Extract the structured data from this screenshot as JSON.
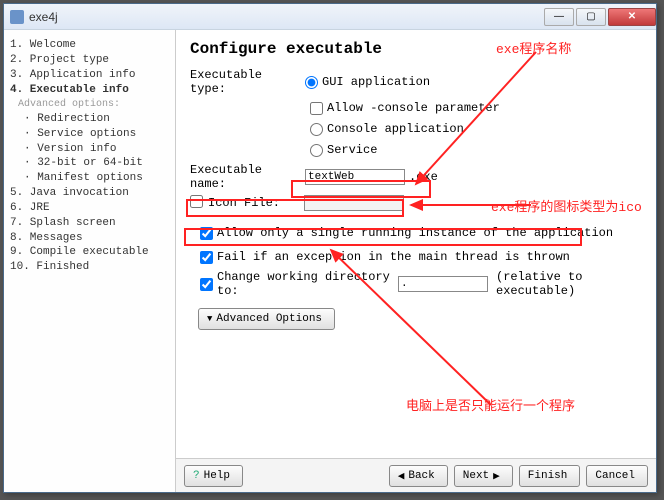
{
  "window": {
    "title": "exe4j"
  },
  "nav": [
    {
      "n": "1.",
      "label": "Welcome"
    },
    {
      "n": "2.",
      "label": "Project type"
    },
    {
      "n": "3.",
      "label": "Application info"
    },
    {
      "n": "4.",
      "label": "Executable info",
      "bold": true
    },
    {
      "adv": true,
      "label": "Advanced options:"
    },
    {
      "sub": true,
      "label": "Redirection"
    },
    {
      "sub": true,
      "label": "Service options"
    },
    {
      "sub": true,
      "label": "Version info"
    },
    {
      "sub": true,
      "label": "32-bit or 64-bit"
    },
    {
      "sub": true,
      "label": "Manifest options"
    },
    {
      "n": "5.",
      "label": "Java invocation"
    },
    {
      "n": "6.",
      "label": "JRE"
    },
    {
      "n": "7.",
      "label": "Splash screen"
    },
    {
      "n": "8.",
      "label": "Messages"
    },
    {
      "n": "9.",
      "label": "Compile executable"
    },
    {
      "n": "10.",
      "label": "Finished"
    }
  ],
  "main": {
    "heading": "Configure executable",
    "exec_type_label": "Executable type:",
    "radio_gui": "GUI application",
    "chk_allow_console": "Allow -console parameter",
    "radio_console": "Console application",
    "radio_service": "Service",
    "exec_name_label": "Executable name:",
    "exec_name_value": "textWeb",
    "exec_ext": ".exe",
    "icon_file_label": "Icon File:",
    "icon_file_value": "",
    "chk_single": "Allow only a single running instance of the application",
    "chk_fail": "Fail if an exception in the main thread is thrown",
    "chk_cwd": "Change working directory to:",
    "cwd_value": ".",
    "cwd_rel": "(relative to executable)",
    "adv_btn": "Advanced Options"
  },
  "footer": {
    "help": "Help",
    "back": "Back",
    "next": "Next",
    "finish": "Finish",
    "cancel": "Cancel"
  },
  "annotations": {
    "a1": "exe程序名称",
    "a2": "exe程序的图标类型为ico",
    "a3": "电脑上是否只能运行一个程序"
  }
}
